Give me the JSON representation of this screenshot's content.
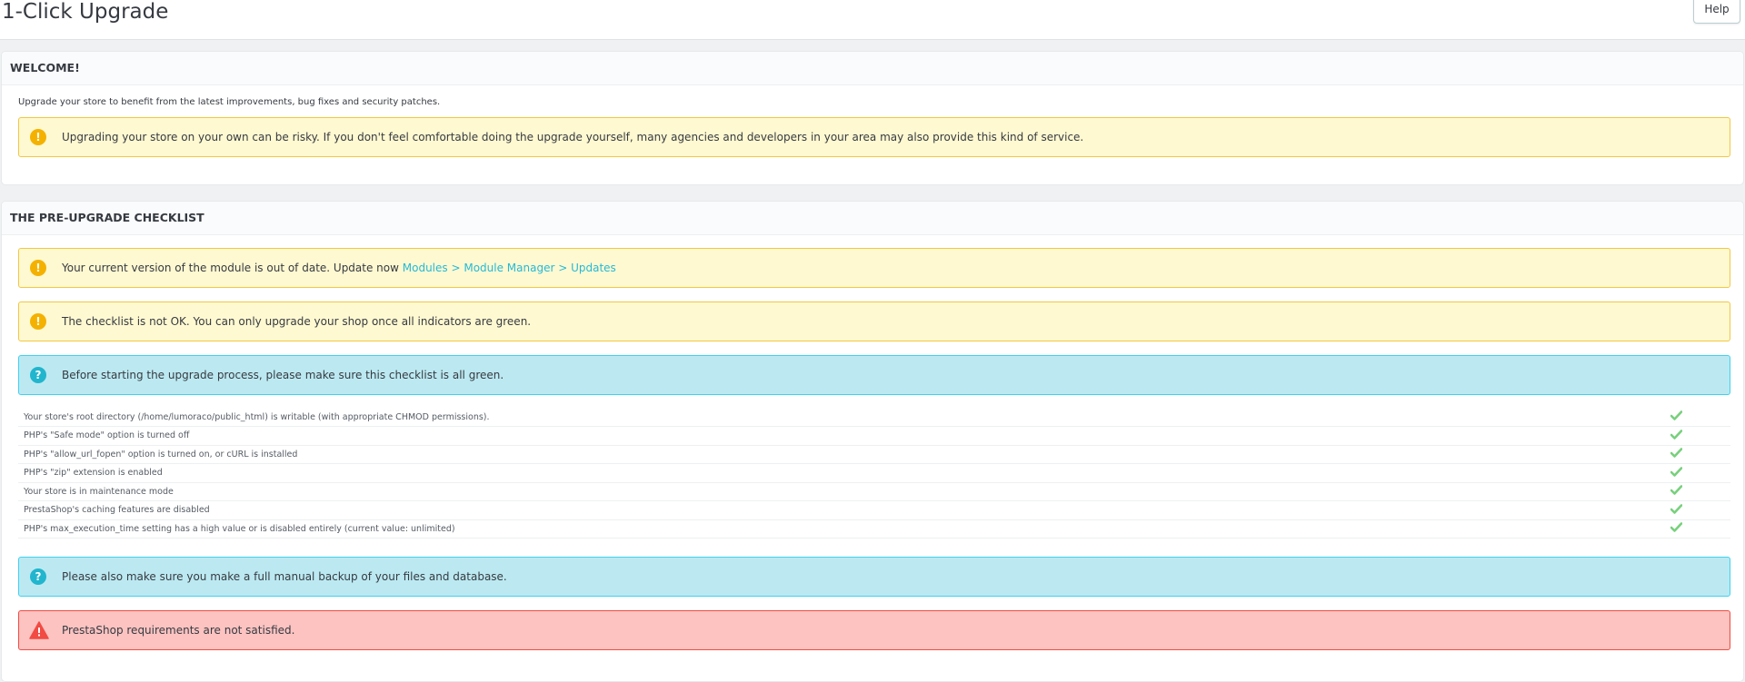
{
  "header": {
    "title": "1-Click Upgrade",
    "help_label": "Help"
  },
  "welcome": {
    "heading": "WELCOME!",
    "intro": "Upgrade your store to benefit from the latest improvements, bug fixes and security patches.",
    "warning": "Upgrading your store on your own can be risky. If you don't feel comfortable doing the upgrade yourself, many agencies and developers in your area may also provide this kind of service."
  },
  "checklist": {
    "heading": "THE PRE-UPGRADE CHECKLIST",
    "module_warning_text": "Your current version of the module is out of date. Update now ",
    "module_warning_link": "Modules > Module Manager > Updates",
    "not_ok_warning": "The checklist is not OK. You can only upgrade your shop once all indicators are green.",
    "before_info": "Before starting the upgrade process, please make sure this checklist is all green.",
    "items": [
      {
        "label": "Your store's root directory (/home/lumoraco/public_html) is writable (with appropriate CHMOD permissions).",
        "ok": true
      },
      {
        "label": "PHP's \"Safe mode\" option is turned off",
        "ok": true
      },
      {
        "label": "PHP's \"allow_url_fopen\" option is turned on, or cURL is installed",
        "ok": true
      },
      {
        "label": "PHP's \"zip\" extension is enabled",
        "ok": true
      },
      {
        "label": "Your store is in maintenance mode",
        "ok": true
      },
      {
        "label": "PrestaShop's caching features are disabled",
        "ok": true
      },
      {
        "label": "PHP's max_execution_time setting has a high value or is disabled entirely (current value: unlimited)",
        "ok": true
      }
    ],
    "backup_info": "Please also make sure you make a full manual backup of your files and database.",
    "requirements_error": "PrestaShop requirements are not satisfied."
  },
  "colors": {
    "warning_bg": "#fff9d1",
    "info_bg": "#bce9f1",
    "danger_bg": "#fcc3c1",
    "check_green": "#78d07d",
    "link": "#25b9d7"
  },
  "icons": {
    "warning": "exclamation-circle-icon",
    "info": "question-circle-icon",
    "danger": "warning-triangle-icon",
    "check": "check-icon"
  }
}
